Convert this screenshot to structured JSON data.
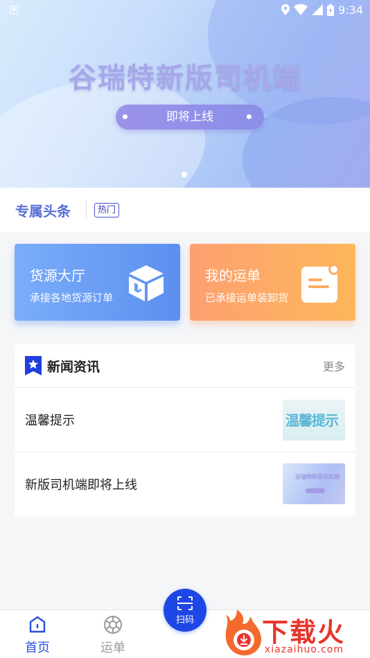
{
  "status_bar": {
    "time": "9:34",
    "icons": [
      "location-icon",
      "wifi-icon",
      "signal-icon",
      "battery-icon"
    ],
    "notification_badge": "A"
  },
  "banner": {
    "title": "谷瑞特新版司机端",
    "pill_label": "即将上线"
  },
  "headline": {
    "title": "专属头条",
    "tag": "热门"
  },
  "cards": {
    "cargo": {
      "title": "货源大厅",
      "subtitle": "承接各地货源订单",
      "icon": "box-icon"
    },
    "orders": {
      "title": "我的运单",
      "subtitle": "已承接运单装卸货",
      "icon": "document-icon"
    }
  },
  "news": {
    "title": "新闻资讯",
    "more": "更多",
    "items": [
      {
        "title": "温馨提示",
        "thumb_text": "温馨提示"
      },
      {
        "title": "新版司机端即将上线",
        "thumb_text": "谷瑞特新版司机端"
      }
    ]
  },
  "nav": {
    "home": "首页",
    "orders": "运单",
    "scan": "扫码"
  },
  "watermark": {
    "brand": "下载火",
    "url": "xiazaihuo.com"
  },
  "colors": {
    "accent": "#1f47e6",
    "headline": "#5a6fd8",
    "card_blue": "#6b9df5",
    "card_orange": "#fdac66",
    "watermark_red": "#e8342a"
  }
}
